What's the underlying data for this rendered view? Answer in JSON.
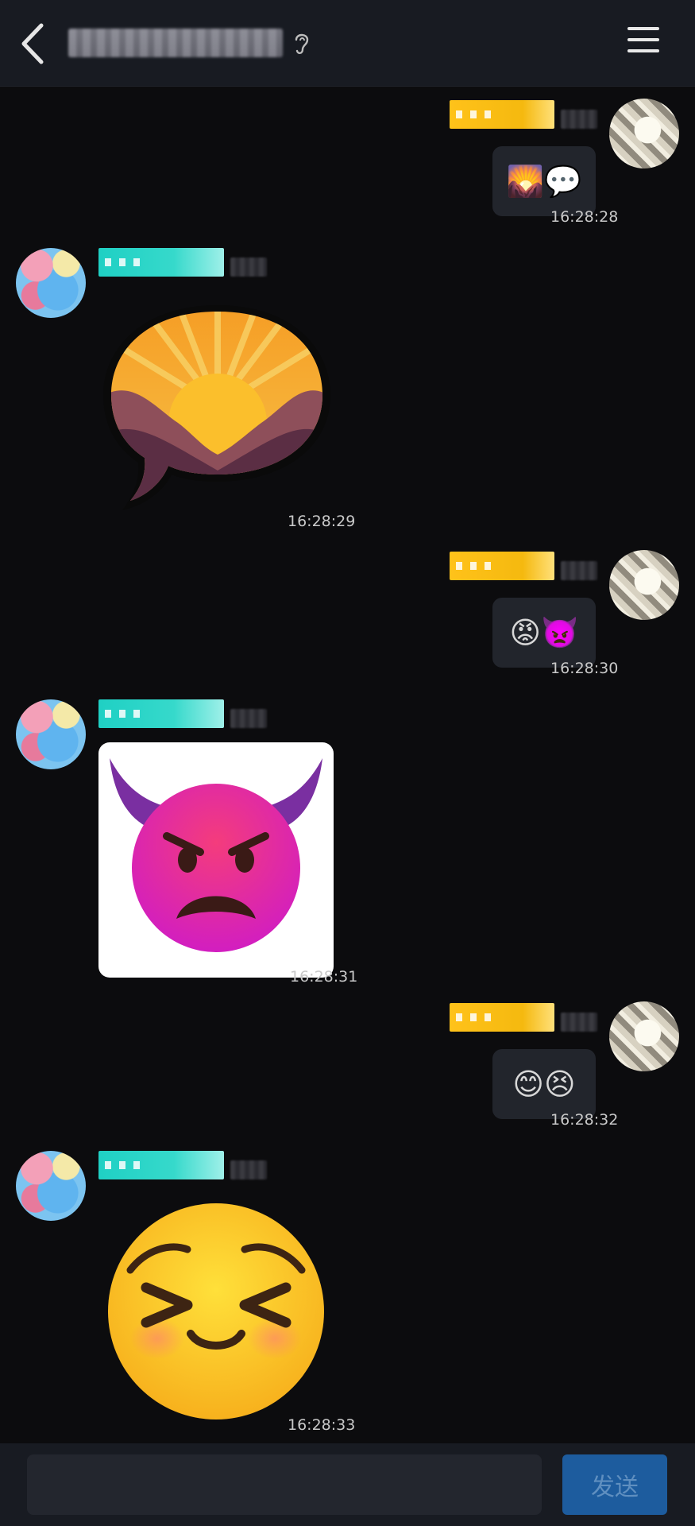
{
  "header": {
    "back_icon": "chevron-left-icon",
    "title": "",
    "listen_icon": "ear-icon",
    "menu_icon": "hamburger-menu-icon"
  },
  "messages": [
    {
      "side": "self",
      "content": "🌄💬",
      "time": "16:28:28"
    },
    {
      "side": "other",
      "content": "sticker: sunrise speech bubble",
      "time": "16:28:29"
    },
    {
      "side": "self",
      "content": "😡👿",
      "time": "16:28:30"
    },
    {
      "side": "other",
      "content": "sticker: angry devil",
      "time": "16:28:31"
    },
    {
      "side": "self",
      "content": "😊😣",
      "time": "16:28:32"
    },
    {
      "side": "other",
      "content": "sticker: persevering face",
      "time": "16:28:33"
    }
  ],
  "composer": {
    "input_value": "",
    "input_placeholder": "",
    "send_label": "发送"
  },
  "colors": {
    "background": "#0c0c0e",
    "header_bg": "#181b22",
    "bubble_bg": "#22252c",
    "self_tag": "#ffc21a",
    "other_tag": "#1fd0c4",
    "send_button": "#1d5c9e"
  }
}
